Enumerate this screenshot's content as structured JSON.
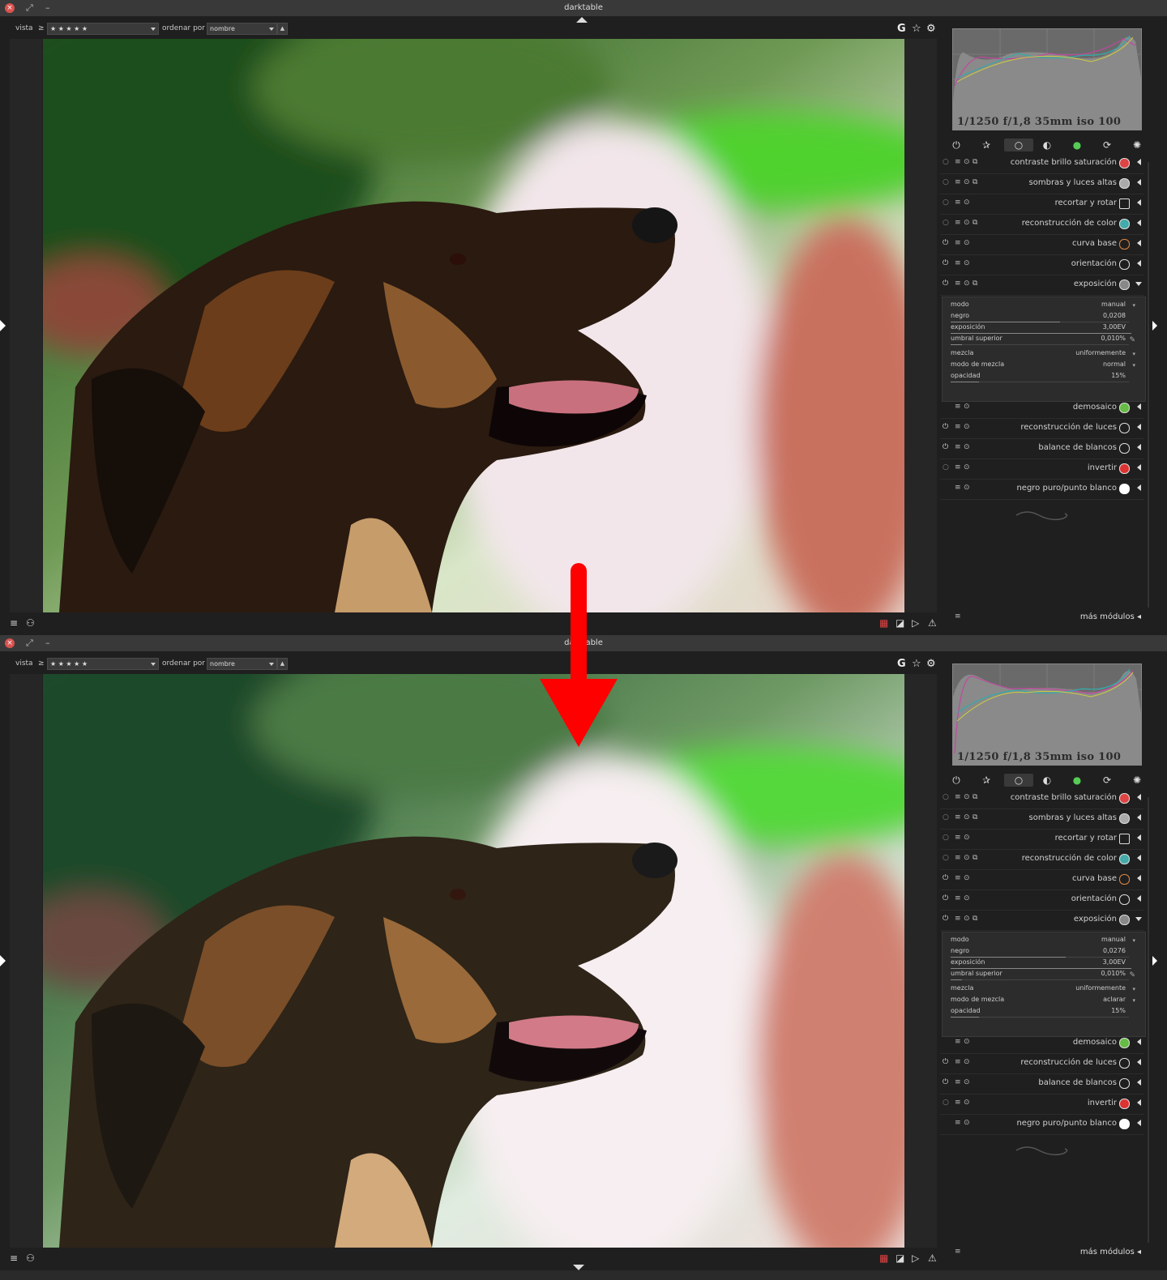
{
  "app": {
    "title": "darktable"
  },
  "screens": [
    {
      "id": "before",
      "toolbar": {
        "view_label": "vista",
        "compare": "≥",
        "rating": "★ ★ ★ ★ ★",
        "sort_label": "ordenar por",
        "sort_value": "nombre",
        "sort_dir": "▲"
      },
      "histogram": {
        "info": "1/1250 f/1,8 35mm iso 100"
      },
      "exposure": {
        "params": [
          {
            "label": "modo",
            "value": "manual",
            "dd": true,
            "fill": 0
          },
          {
            "label": "negro",
            "value": "0,0208",
            "dd": false,
            "fill": 0.58
          },
          {
            "label": "exposición",
            "value": "3,00EV",
            "dd": false,
            "fill": 0.96
          },
          {
            "label": "umbral superior",
            "value": "0,010%",
            "dd": false,
            "fill": 0.06
          },
          {
            "label": "mezcla",
            "value": "uniformemente",
            "dd": true,
            "fill": 0
          },
          {
            "label": "modo de mezcla",
            "value": "normal",
            "dd": true,
            "fill": 0
          },
          {
            "label": "opacidad",
            "value": "15%",
            "dd": false,
            "fill": 0.15
          }
        ]
      }
    },
    {
      "id": "after",
      "toolbar": {
        "view_label": "vista",
        "compare": "≥",
        "rating": "★ ★ ★ ★ ★",
        "sort_label": "ordenar por",
        "sort_value": "nombre",
        "sort_dir": "▲"
      },
      "histogram": {
        "info": "1/1250 f/1,8 35mm iso 100"
      },
      "exposure": {
        "params": [
          {
            "label": "modo",
            "value": "manual",
            "dd": true,
            "fill": 0
          },
          {
            "label": "negro",
            "value": "0,0276",
            "dd": false,
            "fill": 0.61
          },
          {
            "label": "exposición",
            "value": "3,00EV",
            "dd": false,
            "fill": 0.96
          },
          {
            "label": "umbral superior",
            "value": "0,010%",
            "dd": false,
            "fill": 0.06
          },
          {
            "label": "mezcla",
            "value": "uniformemente",
            "dd": true,
            "fill": 0
          },
          {
            "label": "modo de mezcla",
            "value": "aclarar",
            "dd": true,
            "fill": 0
          },
          {
            "label": "opacidad",
            "value": "15%",
            "dd": false,
            "fill": 0.15
          }
        ]
      }
    }
  ],
  "modules_top": [
    {
      "label": "contraste brillo saturación",
      "icon_color": "#d44"
    },
    {
      "label": "sombras y luces altas",
      "icon_color": "#aaa"
    },
    {
      "label": "recortar y rotar",
      "icon_color": "#555"
    },
    {
      "label": "reconstrucción de color",
      "icon_color": "#4aa"
    },
    {
      "label": "curva base",
      "icon_color": "#d84"
    },
    {
      "label": "orientación",
      "icon_color": "#555"
    },
    {
      "label": "exposición",
      "icon_color": "#999"
    }
  ],
  "modules_bottom": [
    {
      "label": "demosaico",
      "icon_color": "#6b4"
    },
    {
      "label": "reconstrucción de luces",
      "icon_color": "#555"
    },
    {
      "label": "balance de blancos",
      "icon_color": "#666"
    },
    {
      "label": "invertir",
      "icon_color": "#d33"
    },
    {
      "label": "negro puro/punto blanco",
      "icon_color": "#fff"
    }
  ],
  "more_modules": "más módulos",
  "icons": {
    "group_icons": [
      "power-icon",
      "favorite-icon",
      "basic-group-icon",
      "tone-group-icon",
      "color-group-icon",
      "correct-group-icon",
      "effect-group-icon"
    ],
    "toolbar_right": [
      "grouping-icon",
      "star-icon",
      "gear-icon"
    ],
    "bottom_left": [
      "presets-menu-icon",
      "styles-icon"
    ],
    "bottom_right": [
      "color-assessment-icon",
      "softproof-icon",
      "gamut-icon",
      "warning-icon"
    ]
  },
  "colors": {
    "arrow": "#ff0000",
    "background": "#1f1f1f"
  }
}
